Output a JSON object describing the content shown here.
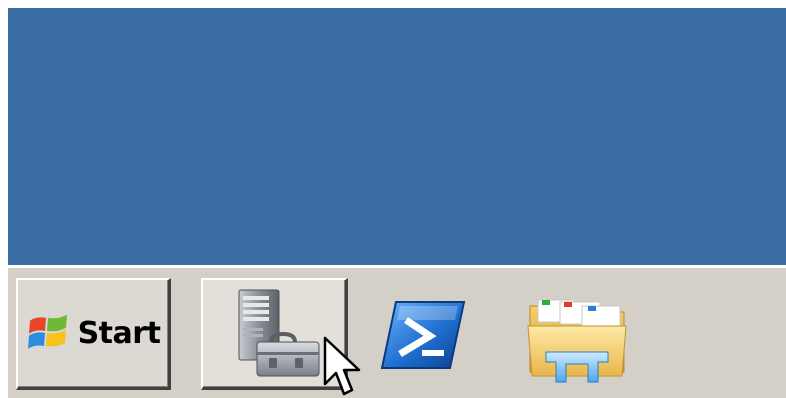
{
  "desktop": {
    "background_color": "#3a6ea5"
  },
  "taskbar": {
    "background_color": "#d4d0c8",
    "start_button": {
      "label": "Start",
      "icon": "windows-flag-icon"
    },
    "tasks": [
      {
        "icon": "server-manager-icon",
        "state": "pressed-style raised button"
      }
    ],
    "quick_launch": [
      {
        "icon": "powershell-icon"
      },
      {
        "icon": "file-explorer-icon"
      }
    ]
  },
  "cursor": {
    "icon": "arrow-pointer-icon"
  }
}
